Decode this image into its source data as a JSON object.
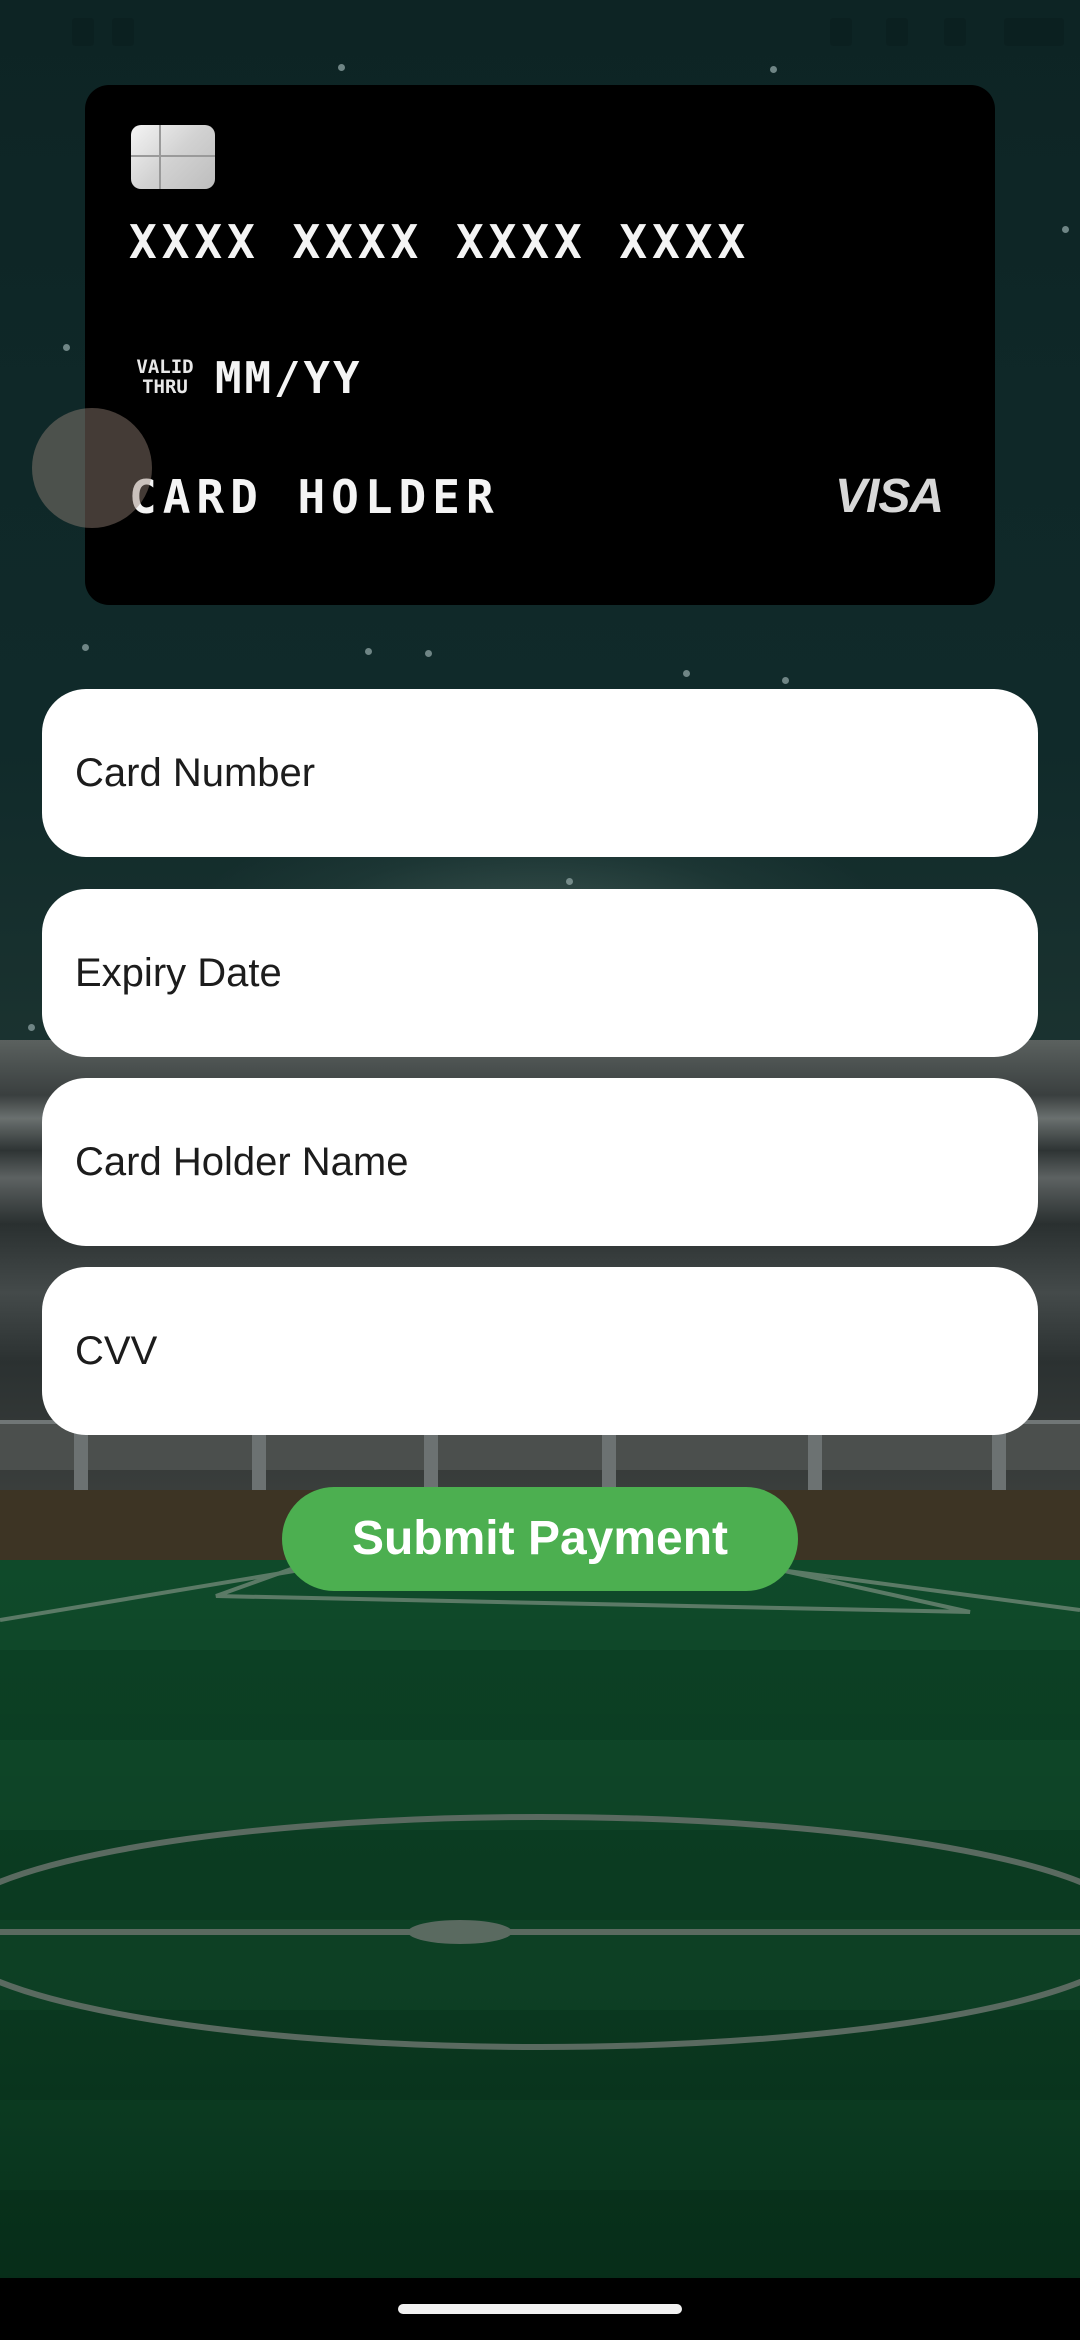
{
  "card_preview": {
    "number": "XXXX XXXX XXXX XXXX",
    "valid_thru_line1": "VALID",
    "valid_thru_line2": "THRU",
    "expiry": "MM/YY",
    "holder": "CARD HOLDER",
    "brand": "VISA"
  },
  "form": {
    "card_number_placeholder": "Card Number",
    "expiry_placeholder": "Expiry Date",
    "holder_placeholder": "Card Holder Name",
    "cvv_placeholder": "CVV",
    "submit_label": "Submit Payment"
  },
  "colors": {
    "submit_button": "#4caf50",
    "card_background": "#000000",
    "field_background": "#ffffff"
  },
  "icons": {
    "card_chip": "card-chip-icon",
    "card_brand": "visa-logo"
  }
}
